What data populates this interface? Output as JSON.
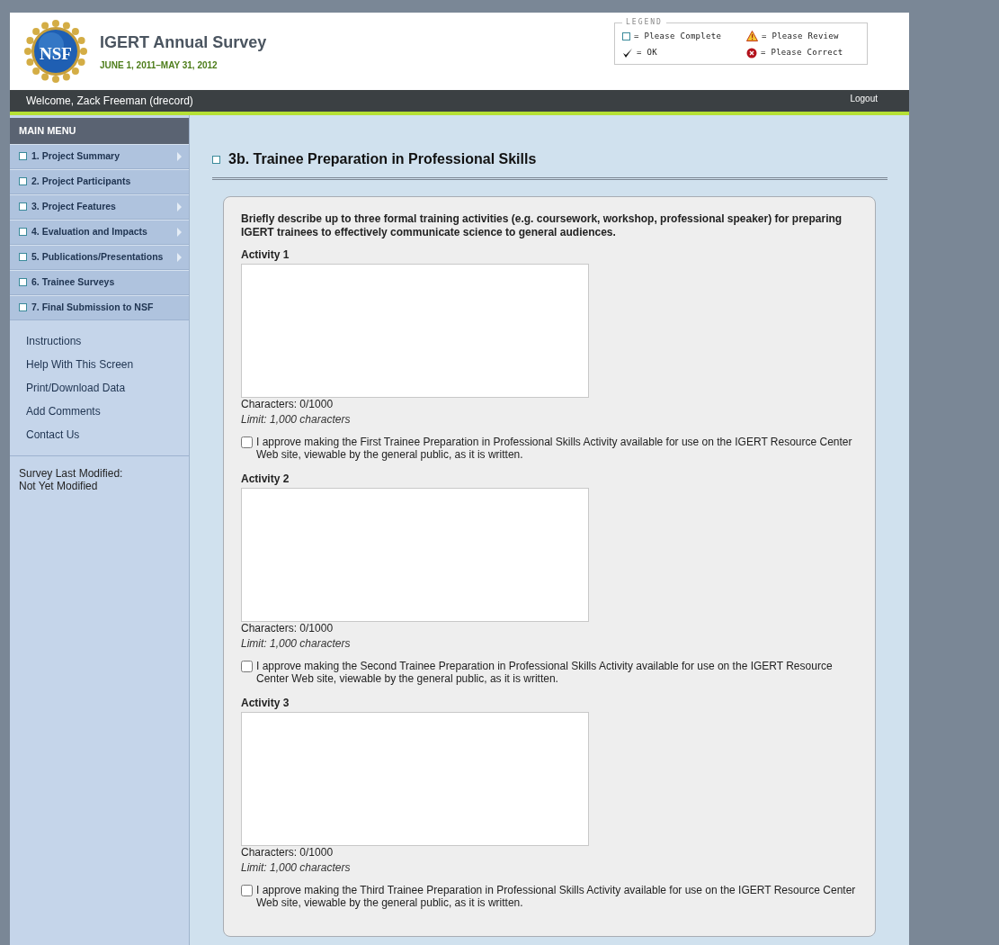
{
  "header": {
    "logo_text": "NSF",
    "title": "IGERT Annual Survey",
    "period": "JUNE 1, 2011–MAY 31, 2012"
  },
  "legend": {
    "title": "LEGEND",
    "items": [
      {
        "kind": "square",
        "label": "= Please Complete"
      },
      {
        "kind": "warning",
        "label": "= Please Review"
      },
      {
        "kind": "check",
        "label": "= OK"
      },
      {
        "kind": "error",
        "label": "= Please Correct"
      }
    ]
  },
  "topbar": {
    "welcome": "Welcome, Zack Freeman (drecord)",
    "logout": "Logout"
  },
  "sidebar": {
    "heading": "MAIN MENU",
    "items": [
      {
        "complete": false,
        "label": "1. Project Summary",
        "has_submenu": true
      },
      {
        "complete": false,
        "label": "2. Project Participants",
        "has_submenu": false
      },
      {
        "complete": false,
        "label": "3. Project Features",
        "has_submenu": true
      },
      {
        "complete": false,
        "label": "4. Evaluation and Impacts",
        "has_submenu": true
      },
      {
        "complete": false,
        "label": "5. Publications/Presentations",
        "has_submenu": true
      },
      {
        "complete": false,
        "label": "6. Trainee Surveys",
        "has_submenu": false
      },
      {
        "complete": false,
        "label": "7. Final Submission to NSF",
        "has_submenu": false
      }
    ],
    "links": [
      "Instructions",
      "Help With This Screen",
      "Print/Download Data",
      "Add Comments",
      "Contact Us"
    ],
    "modified_label": "Survey Last Modified:",
    "modified_value": "Not Yet Modified"
  },
  "section": {
    "complete": false,
    "title": "3b. Trainee Preparation in Professional Skills",
    "question": "Briefly describe up to three formal training activities (e.g. coursework, workshop, professional speaker) for preparing IGERT trainees to effectively communicate science to general audiences.",
    "activities": [
      {
        "label": "Activity 1",
        "counter": "Characters: 0/1000",
        "limit": "Limit: 1,000 characters",
        "approval": "I approve making the First Trainee Preparation in Professional Skills Activity available for use on the IGERT Resource Center Web site, viewable by the general public, as it is written.",
        "checked": false
      },
      {
        "label": "Activity 2",
        "counter": "Characters: 0/1000",
        "limit": "Limit: 1,000 characters",
        "approval": "I approve making the Second Trainee Preparation in Professional Skills Activity available for use on the IGERT Resource Center Web site, viewable by the general public, as it is written.",
        "checked": false
      },
      {
        "label": "Activity 3",
        "counter": "Characters: 0/1000",
        "limit": "Limit: 1,000 characters",
        "approval": "I approve making the Third Trainee Preparation in Professional Skills Activity available for use on the IGERT Resource Center Web site, viewable by the general public, as it is written.",
        "checked": false
      }
    ]
  }
}
